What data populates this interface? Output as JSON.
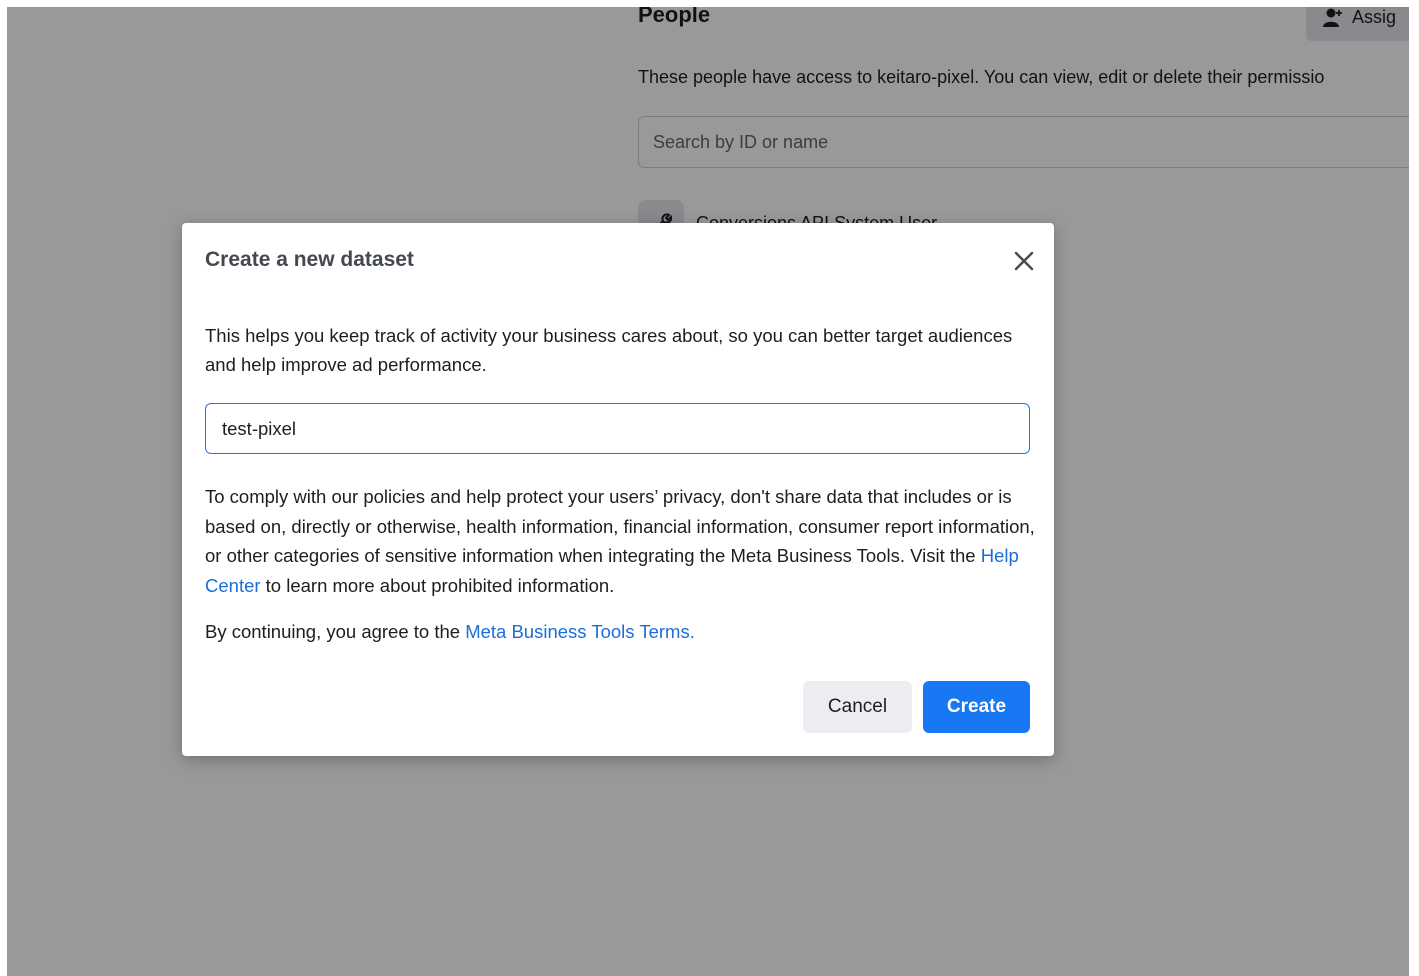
{
  "background": {
    "title": "People",
    "assign_label": "Assig",
    "description": "These people have access to keitaro-pixel. You can view, edit or delete their permissio",
    "search_placeholder": "Search by ID or name",
    "user_row_name": "Conversions API System User"
  },
  "dialog": {
    "title": "Create a new dataset",
    "intro": "This helps you keep track of activity your business cares about, so you can better target audiences and help improve ad performance.",
    "input_value": "test-pixel",
    "policy_before": "To comply with our policies and help protect your users’ privacy, don't share data that includes or is based on, directly or otherwise, health information, financial information, consumer report information, or other categories of sensitive information when integrating the Meta Business Tools. Visit the ",
    "policy_link": "Help Center",
    "policy_after": " to learn more about prohibited information.",
    "terms_before": "By continuing, you agree to the ",
    "terms_link": "Meta Business Tools Terms.",
    "cancel_label": "Cancel",
    "create_label": "Create"
  },
  "colors": {
    "primary": "#1877f2",
    "link": "#1a6ed8",
    "overlay": "rgba(0,0,0,0.4)"
  }
}
